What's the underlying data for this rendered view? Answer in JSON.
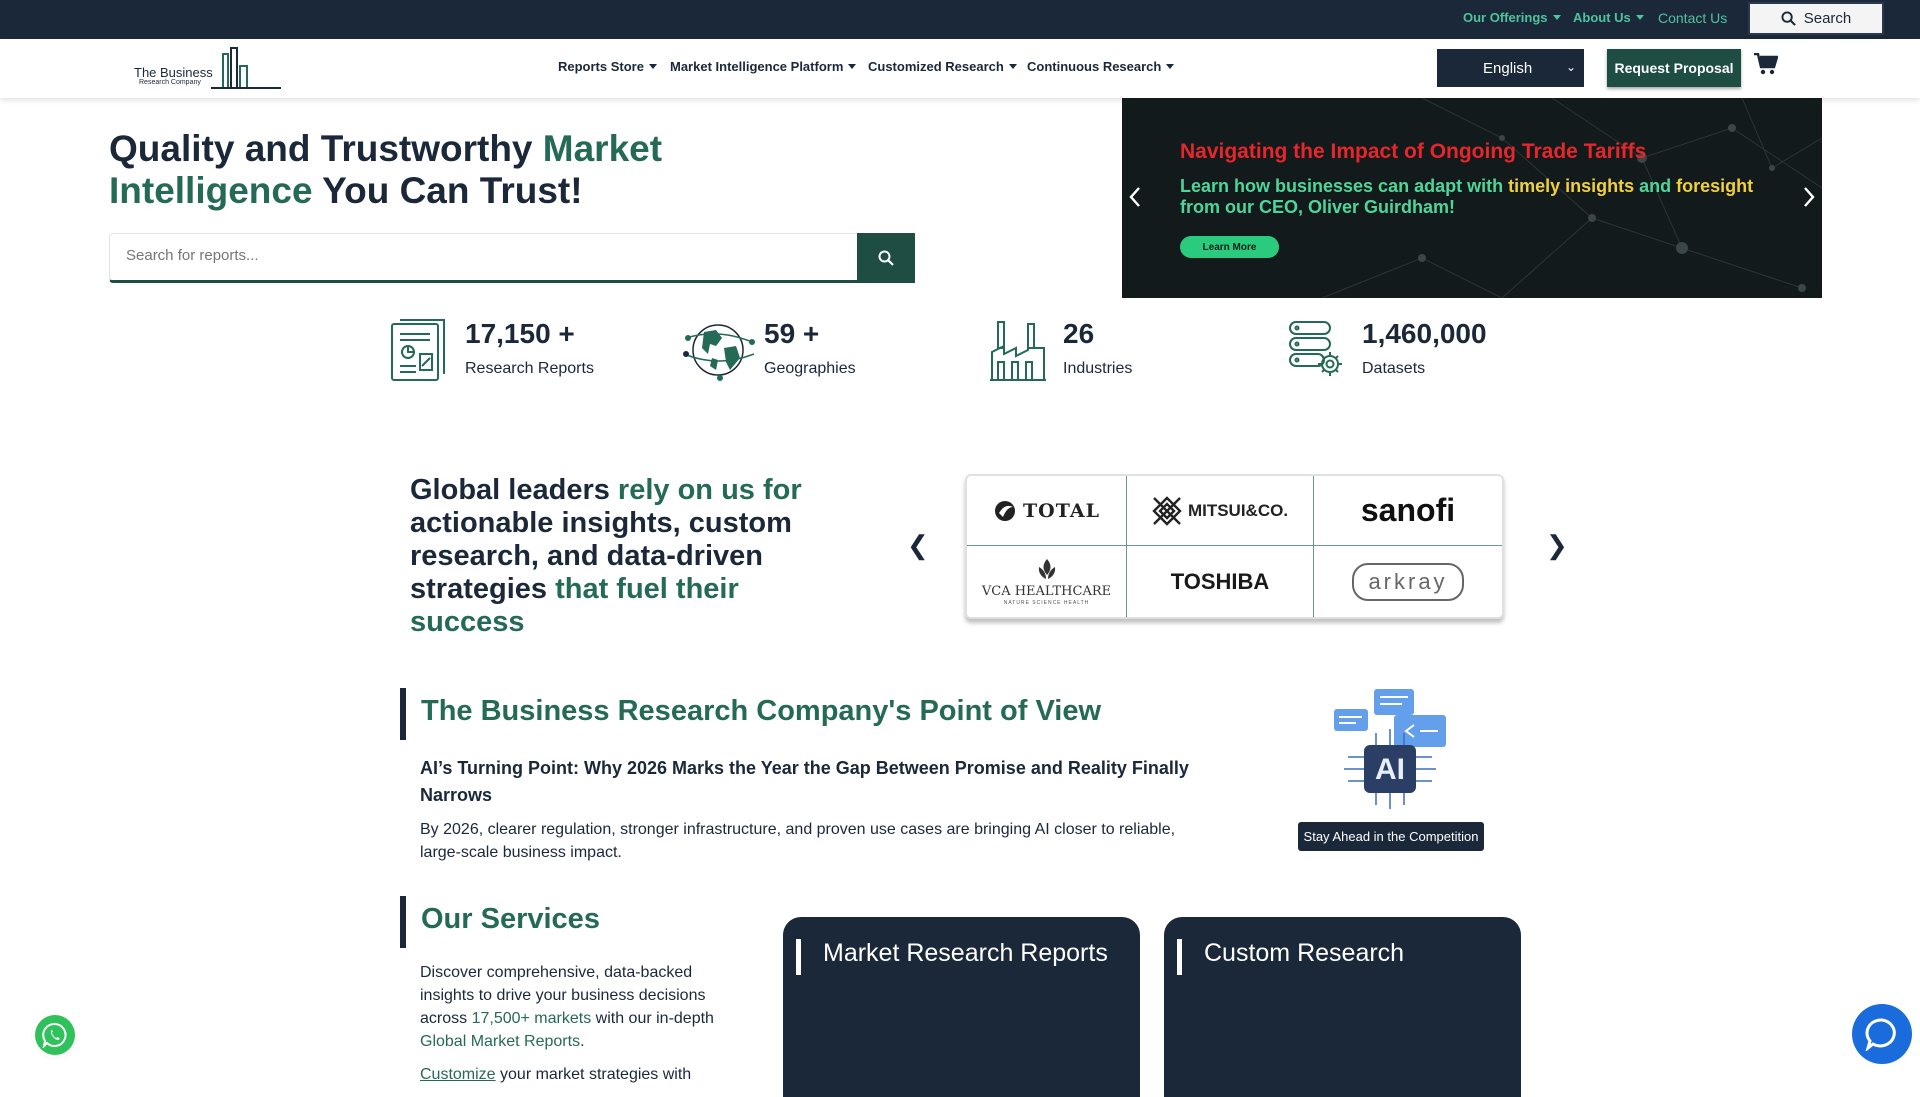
{
  "topbar": {
    "offerings": "Our Offerings",
    "about": "About Us",
    "contact": "Contact Us",
    "search": "Search"
  },
  "nav": {
    "logo_line1": "The Business",
    "logo_line2": "Research Company",
    "items": [
      "Reports Store",
      "Market Intelligence Platform",
      "Customized Research",
      "Continuous Research"
    ],
    "language": "English",
    "request_proposal": "Request Proposal"
  },
  "hero": {
    "title_part1": "Quality and Trustworthy ",
    "title_green1": "Market",
    "title_green2": "Intelligence",
    "title_part2": " You Can Trust!",
    "search_placeholder": "Search for reports..."
  },
  "banner": {
    "title": "Navigating the Impact of Ongoing Trade Tariffs",
    "sub_part1": "Learn how businesses can adapt with ",
    "sub_yellow1": "timely insights",
    "sub_part2": " and ",
    "sub_yellow2": "foresight",
    "sub_part3": "from our CEO, Oliver Guirdham!",
    "button": "Learn More"
  },
  "stats": [
    {
      "value": "17,150 +",
      "label": "Research Reports"
    },
    {
      "value": "59 +",
      "label": "Geographies"
    },
    {
      "value": "26",
      "label": "Industries"
    },
    {
      "value": "1,460,000",
      "label": "Datasets"
    }
  ],
  "leaders": {
    "part1": "Global leaders ",
    "green1": "rely on us for",
    "part2": "actionable insights, custom research, and data-driven strategies ",
    "green2": "that fuel their success",
    "prev": "❮",
    "next": "❯",
    "logos": {
      "total": "TOTAL",
      "mitsui": "MITSUI&CO.",
      "sanofi": "sanofi",
      "vca": "VCA HEALTHCARE",
      "vca_sub": "NATURE SCIENCE HEALTH",
      "toshiba": "TOSHIBA",
      "arkray": "arkray"
    }
  },
  "pov": {
    "title": "The Business Research Company's Point of View",
    "article_title": "AI’s Turning Point: Why 2026 Marks the Year the Gap Between Promise and Reality Finally Narrows",
    "article_desc": "By 2026, clearer regulation, stronger infrastructure, and proven use cases are bringing AI closer to reliable, large-scale business impact.",
    "badge": "Stay Ahead in the Competition",
    "ai_label": "AI"
  },
  "services": {
    "title": "Our Services",
    "desc_part1": "Discover comprehensive, data-backed insights to drive your business decisions across ",
    "desc_link1": "17,500+ markets",
    "desc_part2": " with our in-depth ",
    "desc_link2": "Global Market Reports",
    "desc_part3": ".",
    "desc2_link": "Customize",
    "desc2_rest": " your market strategies with",
    "cards": [
      "Market Research Reports",
      "Custom Research"
    ]
  },
  "colors": {
    "navy": "#1b283a",
    "green": "#256a57",
    "accent_green": "#4fc39a",
    "banner_red": "#e6262b",
    "banner_yellow": "#f0d03c"
  }
}
